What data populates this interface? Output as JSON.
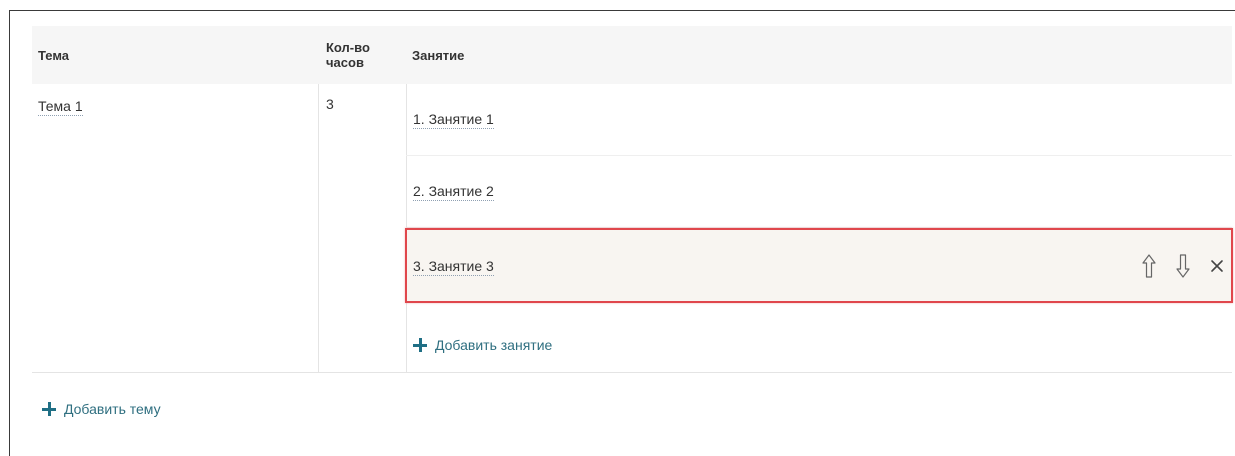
{
  "table": {
    "headers": {
      "topic": "Тема",
      "hours": "Кол-во часов",
      "lesson": "Занятие"
    },
    "topics": [
      {
        "name": "Тема 1",
        "hours": "3",
        "lessons": [
          {
            "label": "1. Занятие 1"
          },
          {
            "label": "2. Занятие 2"
          },
          {
            "label": "3. Занятие 3",
            "highlighted": true
          }
        ]
      }
    ],
    "add_lesson_label": "Добавить занятие",
    "add_topic_label": "Добавить тему"
  },
  "icons": {
    "move_up": "arrow-up-icon",
    "move_down": "arrow-down-icon",
    "delete": "close-icon",
    "add": "plus-icon"
  },
  "colors": {
    "accent": "#1f6f85",
    "highlight_border": "#e0474c",
    "highlight_bg": "#f8f5f1",
    "header_bg": "#f6f6f6"
  }
}
